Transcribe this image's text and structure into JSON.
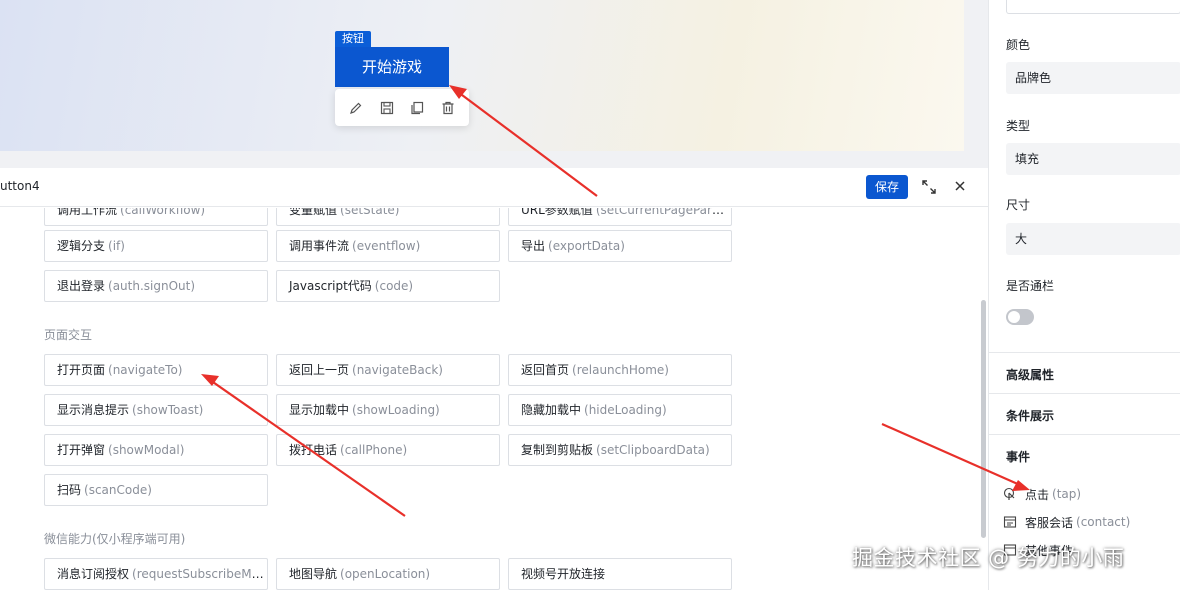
{
  "canvas": {
    "tag_label": "按钮",
    "button_label": "开始游戏",
    "toolbar_icons": [
      "edit-icon",
      "save-icon",
      "copy-icon",
      "delete-icon"
    ]
  },
  "event_panel": {
    "title": "utton4",
    "save_label": "保存",
    "groups": [
      {
        "rows": [
          [
            {
              "name": "调用工作流",
              "code": "(callWorkflow)"
            },
            {
              "name": "变量赋值",
              "code": "(setState)"
            },
            {
              "name": "URL参数赋值",
              "code": "(setCurrentPageParams)"
            }
          ],
          [
            {
              "name": "逻辑分支",
              "code": "(if)"
            },
            {
              "name": "调用事件流",
              "code": "(eventflow)"
            },
            {
              "name": "导出",
              "code": "(exportData)"
            }
          ],
          [
            {
              "name": "退出登录",
              "code": "(auth.signOut)"
            },
            {
              "name": "Javascript代码",
              "code": "(code)"
            }
          ]
        ]
      },
      {
        "title": "页面交互",
        "rows": [
          [
            {
              "name": "打开页面",
              "code": "(navigateTo)"
            },
            {
              "name": "返回上一页",
              "code": "(navigateBack)"
            },
            {
              "name": "返回首页",
              "code": "(relaunchHome)"
            }
          ],
          [
            {
              "name": "显示消息提示",
              "code": "(showToast)"
            },
            {
              "name": "显示加载中",
              "code": "(showLoading)"
            },
            {
              "name": "隐藏加载中",
              "code": "(hideLoading)"
            }
          ],
          [
            {
              "name": "打开弹窗",
              "code": "(showModal)"
            },
            {
              "name": "拨打电话",
              "code": "(callPhone)"
            },
            {
              "name": "复制到剪贴板",
              "code": "(setClipboardData)"
            }
          ],
          [
            {
              "name": "扫码",
              "code": "(scanCode)"
            }
          ]
        ]
      },
      {
        "title": "微信能力(仅小程序端可用)",
        "rows": [
          [
            {
              "name": "消息订阅授权",
              "code": "(requestSubscribeMessage)"
            },
            {
              "name": "地图导航",
              "code": "(openLocation)"
            },
            {
              "name": "视频号开放连接",
              "code": ""
            }
          ]
        ]
      }
    ]
  },
  "sidebar": {
    "color_label": "颜色",
    "color_value": "品牌色",
    "type_label": "类型",
    "type_value": "填充",
    "size_label": "尺寸",
    "size_value": "大",
    "fullwidth_label": "是否通栏",
    "fullwidth_on": false,
    "advanced_label": "高级属性",
    "condition_label": "条件展示",
    "events_label": "事件",
    "events": [
      {
        "name": "点击",
        "code": "(tap)",
        "icon": "tap-icon"
      },
      {
        "name": "客服会话",
        "code": "(contact)",
        "icon": "contact-icon"
      },
      {
        "name": "其他事件",
        "code": "",
        "icon": "event-icon"
      }
    ]
  },
  "watermark": "掘金技术社区 @ 努力的小雨",
  "colors": {
    "brand": "#0b57d0",
    "arrow": "#e8302a",
    "muted": "#8a8f99"
  }
}
